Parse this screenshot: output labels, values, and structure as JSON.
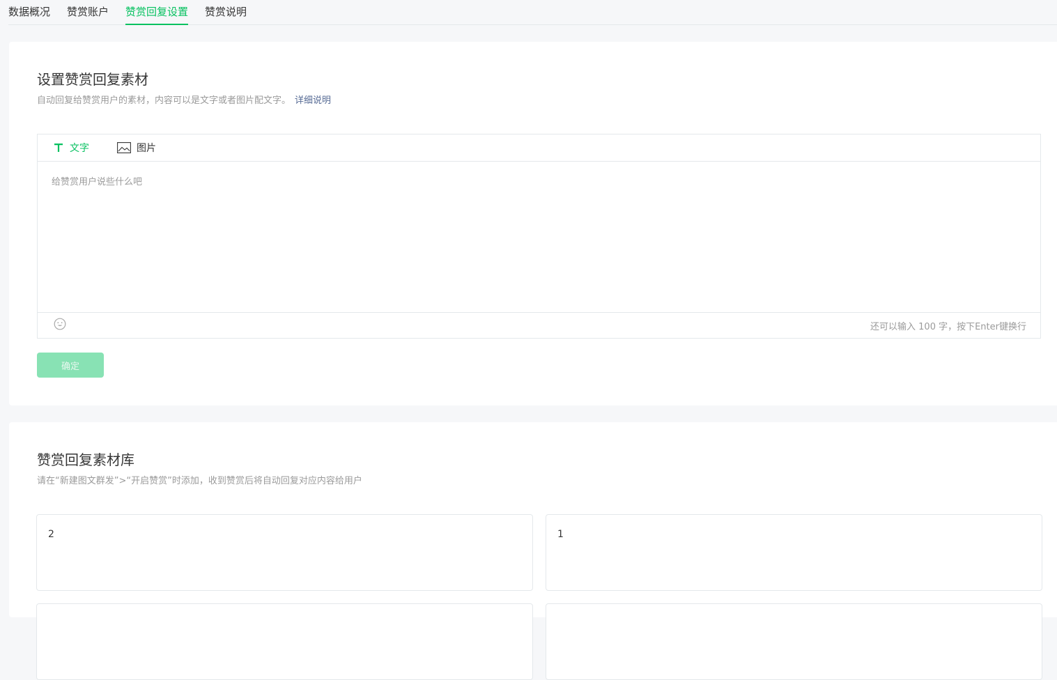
{
  "tabs": [
    {
      "label": "数据概况",
      "active": false
    },
    {
      "label": "赞赏账户",
      "active": false
    },
    {
      "label": "赞赏回复设置",
      "active": true
    },
    {
      "label": "赞赏说明",
      "active": false
    }
  ],
  "reply_material": {
    "title": "设置赞赏回复素材",
    "description": "自动回复给赞赏用户的素材，内容可以是文字或者图片配文字。",
    "detail_link": "详细说明",
    "editor": {
      "tab_text": "文字",
      "tab_image": "图片",
      "placeholder": "给赞赏用户说些什么吧",
      "counter": "还可以输入 100 字，按下Enter键换行"
    },
    "confirm_label": "确定"
  },
  "library": {
    "title": "赞赏回复素材库",
    "description": "请在“新建图文群发”>“开启赞赏”时添加，收到赞赏后将自动回复对应内容给用户",
    "items": [
      "2",
      "1",
      "",
      ""
    ]
  },
  "colors": {
    "accent": "#07c160",
    "link": "#576b95",
    "disabled_button": "#88e2b4"
  }
}
